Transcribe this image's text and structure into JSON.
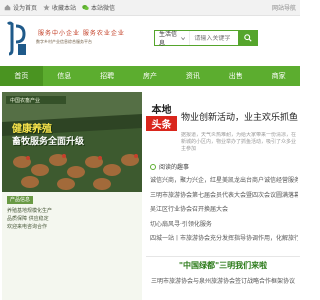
{
  "topbar": {
    "items": [
      {
        "label": "设为首页",
        "icon": "home-icon"
      },
      {
        "label": "收藏本站",
        "icon": "star-icon"
      },
      {
        "label": "本站微信",
        "icon": "wechat-icon"
      }
    ],
    "right_text": "网站导航"
  },
  "header": {
    "slogan": "服务中小企业  服务农业企业",
    "slogan_sub": "数字乡村产业信息综合服务平台",
    "search": {
      "select_label": "生活信息",
      "placeholder": "请输入关键字"
    }
  },
  "nav": {
    "items": [
      "首页",
      "信息",
      "招聘",
      "房产",
      "资讯",
      "出售",
      "商家"
    ],
    "active_index": 0
  },
  "banner": {
    "title_line1": "健康养殖",
    "title_line2": "畜牧服务全面升级",
    "company": "中国农畜产业"
  },
  "infobox": {
    "heading": "产品信息",
    "lines": [
      "养殖基地规模化生产",
      "品质保障 供应稳定",
      "欢迎来电咨询合作"
    ]
  },
  "feature_news": {
    "badge_top": "本地",
    "badge_bottom": "头条",
    "headline": "物业创新活动，业主欢乐抓鱼",
    "summary": "据报道，天气炎热难耐，为给大家带来一份清凉，在新城的小区内，物业举办了抓鱼活动，吸引了众多业主参加"
  },
  "section": {
    "title": "阅读的趣事"
  },
  "news_list": [
    "诚信兴商，聚力兴企，红星美凯龙出台商户诚信经营服务",
    "三明市旅游协会第七届会员代表大会暨四次会议圆满落幕",
    "吴江区行业协会召开换届大会",
    "切心扇风寻·引领化服务",
    "四城一站丨市旅游协会充分发挥指导协调作用，化解旅行社",
    "三明市旅游协会与泉州旅游协会签订战略合作框架协议"
  ],
  "feature": {
    "title": "\"中国绿都\"三明我们来啦",
    "subtitle": "三明市旅游协会与泉州旅游协会签订战略合作框架协议"
  },
  "colors": {
    "brand_green": "#5cad2f",
    "badge_red": "#d9261c"
  }
}
